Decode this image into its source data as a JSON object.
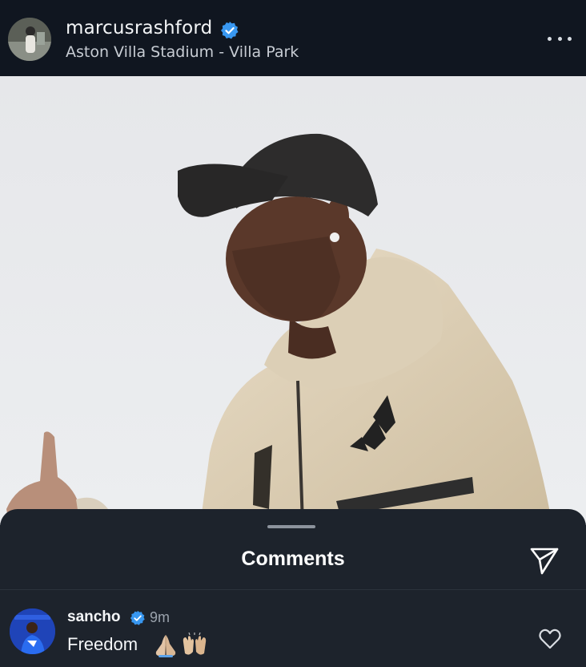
{
  "post": {
    "username": "marcusrashford",
    "location": "Aston Villa Stadium - Villa Park",
    "verified": true,
    "icons": {
      "avatar": "profile-avatar",
      "verified": "verified-badge-icon",
      "more": "more-options-icon"
    },
    "image": {
      "description": "photo of man in cap and hoodie giving thumbs up",
      "background_color": "#e7e8eb"
    }
  },
  "comments_sheet": {
    "title": "Comments",
    "send_icon": "send-icon",
    "comment": {
      "username": "sancho",
      "verified": true,
      "time": "9m",
      "text": "Freedom",
      "emojis": [
        "folded-hands-emoji",
        "raised-hands-emoji"
      ],
      "like_icon": "heart-icon"
    }
  },
  "colors": {
    "background": "#0f141b",
    "sheet": "#1d232c",
    "verified_blue": "#3897f0",
    "text_primary": "#ffffff",
    "text_secondary": "#9aa2ac"
  }
}
